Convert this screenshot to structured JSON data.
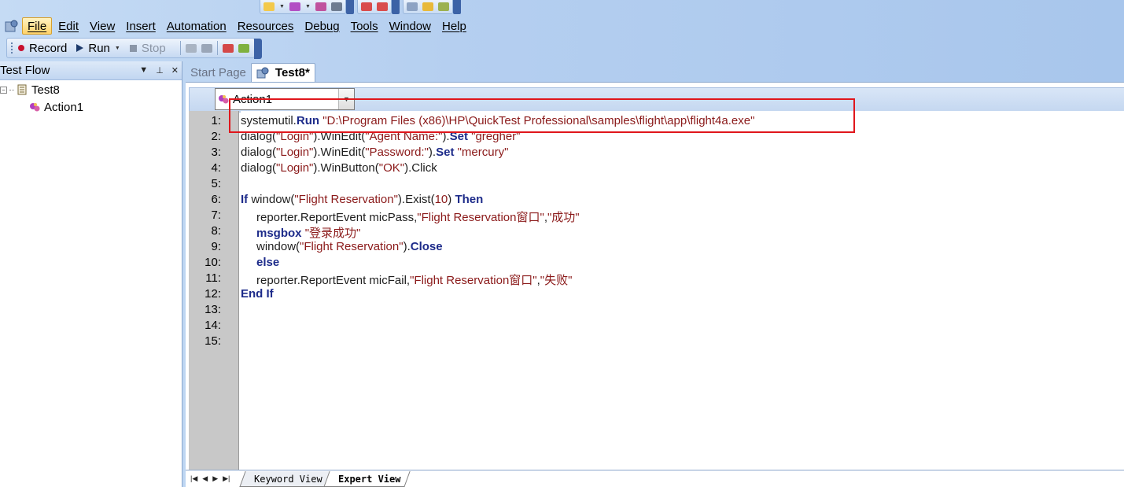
{
  "colors": {
    "keyword": "#1d2b8a",
    "string": "#8b1a1a",
    "highlight_border": "#e0161c",
    "menu_active": "#ffd36a"
  },
  "menu": {
    "items": [
      "File",
      "Edit",
      "View",
      "Insert",
      "Automation",
      "Resources",
      "Debug",
      "Tools",
      "Window",
      "Help"
    ],
    "active": "File"
  },
  "toolbar": {
    "record_label": "Record",
    "run_label": "Run",
    "stop_label": "Stop"
  },
  "test_flow": {
    "title": "Test Flow",
    "test_name": "Test8",
    "action_name": "Action1"
  },
  "doc_tabs": {
    "start_page": "Start Page",
    "current": "Test8*"
  },
  "editor": {
    "action_selected": "Action1",
    "line_numbers": [
      "1:",
      "2:",
      "3:",
      "4:",
      "5:",
      "6:",
      "7:",
      "8:",
      "9:",
      "10:",
      "11:",
      "12:",
      "13:",
      "14:",
      "15:"
    ],
    "lines": [
      {
        "indent": 0,
        "parts": [
          {
            "t": "systemutil.",
            "c": "n"
          },
          {
            "t": "Run",
            "c": "k"
          },
          {
            "t": " ",
            "c": "n"
          },
          {
            "t": "\"D:\\Program Files (x86)\\HP\\QuickTest Professional\\samples\\flight\\app\\flight4a.exe\"",
            "c": "s"
          }
        ]
      },
      {
        "indent": 0,
        "parts": [
          {
            "t": "dialog(",
            "c": "n"
          },
          {
            "t": "\"Login\"",
            "c": "s"
          },
          {
            "t": ").WinEdit(",
            "c": "n"
          },
          {
            "t": "\"Agent Name:\"",
            "c": "s"
          },
          {
            "t": ").",
            "c": "n"
          },
          {
            "t": "Set",
            "c": "k"
          },
          {
            "t": " ",
            "c": "n"
          },
          {
            "t": "\"gregher\"",
            "c": "s"
          }
        ]
      },
      {
        "indent": 0,
        "parts": [
          {
            "t": "dialog(",
            "c": "n"
          },
          {
            "t": "\"Login\"",
            "c": "s"
          },
          {
            "t": ").WinEdit(",
            "c": "n"
          },
          {
            "t": "\"Password:\"",
            "c": "s"
          },
          {
            "t": ").",
            "c": "n"
          },
          {
            "t": "Set",
            "c": "k"
          },
          {
            "t": " ",
            "c": "n"
          },
          {
            "t": "\"mercury\"",
            "c": "s"
          }
        ]
      },
      {
        "indent": 0,
        "parts": [
          {
            "t": "dialog(",
            "c": "n"
          },
          {
            "t": "\"Login\"",
            "c": "s"
          },
          {
            "t": ").WinButton(",
            "c": "n"
          },
          {
            "t": "\"OK\"",
            "c": "s"
          },
          {
            "t": ").Click",
            "c": "n"
          }
        ]
      },
      {
        "indent": 0,
        "parts": []
      },
      {
        "indent": 0,
        "parts": [
          {
            "t": "If",
            "c": "k"
          },
          {
            "t": " window(",
            "c": "n"
          },
          {
            "t": "\"Flight Reservation\"",
            "c": "s"
          },
          {
            "t": ").Exist(",
            "c": "n"
          },
          {
            "t": "10",
            "c": "s"
          },
          {
            "t": ") ",
            "c": "n"
          },
          {
            "t": "Then",
            "c": "k"
          }
        ]
      },
      {
        "indent": 1,
        "parts": [
          {
            "t": "reporter.ReportEvent micPass,",
            "c": "n"
          },
          {
            "t": "\"Flight Reservation窗口\"",
            "c": "s"
          },
          {
            "t": ",",
            "c": "n"
          },
          {
            "t": "\"成功\"",
            "c": "s"
          }
        ]
      },
      {
        "indent": 1,
        "parts": [
          {
            "t": "msgbox",
            "c": "k"
          },
          {
            "t": " ",
            "c": "n"
          },
          {
            "t": "\"登录成功\"",
            "c": "s"
          }
        ]
      },
      {
        "indent": 1,
        "parts": [
          {
            "t": "window(",
            "c": "n"
          },
          {
            "t": "\"Flight Reservation\"",
            "c": "s"
          },
          {
            "t": ").",
            "c": "n"
          },
          {
            "t": "Close",
            "c": "k"
          }
        ]
      },
      {
        "indent": 1,
        "parts": [
          {
            "t": "else",
            "c": "k"
          }
        ]
      },
      {
        "indent": 1,
        "parts": [
          {
            "t": "reporter.ReportEvent micFail,",
            "c": "n"
          },
          {
            "t": "\"Flight Reservation窗口\"",
            "c": "s"
          },
          {
            "t": ",",
            "c": "n"
          },
          {
            "t": "\"失败\"",
            "c": "s"
          }
        ]
      },
      {
        "indent": 0,
        "parts": [
          {
            "t": "End If",
            "c": "k"
          }
        ]
      },
      {
        "indent": 0,
        "parts": []
      },
      {
        "indent": 0,
        "parts": []
      },
      {
        "indent": 0,
        "parts": []
      }
    ]
  },
  "view_tabs": {
    "keyword_view": "Keyword View",
    "expert_view": "Expert View",
    "active": "Expert View"
  }
}
